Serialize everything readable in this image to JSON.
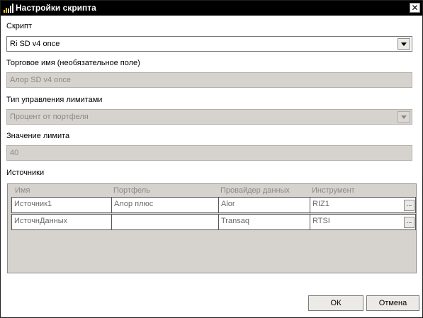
{
  "window": {
    "title": "Настройки скрипта",
    "icon": "bar-chart-icon",
    "close_label": "✕"
  },
  "script": {
    "label": "Скрипт",
    "value": "Ri SD v4 once"
  },
  "trade_name": {
    "label": "Торговое имя (необязательное поле)",
    "value": "Алор SD v4 once"
  },
  "limit_type": {
    "label": "Тип управления лимитами",
    "value": "Процент от портфеля"
  },
  "limit_value": {
    "label": "Значение лимита",
    "value": "40"
  },
  "sources": {
    "label": "Источники",
    "columns": [
      "Имя",
      "Портфель",
      "Провайдер данных",
      "Инструмент"
    ],
    "rows": [
      {
        "name": "Источник1",
        "portfolio": "Алор плюс",
        "provider": "Alor",
        "instrument": "RIZ1"
      },
      {
        "name": "ИсточнДанных",
        "portfolio": "",
        "provider": "Transaq",
        "instrument": "RTSI"
      }
    ],
    "ellipsis_label": "..."
  },
  "buttons": {
    "ok": "ОК",
    "cancel": "Отмена"
  },
  "colors": {
    "titlebar": "#000000",
    "disabled_field": "#d6d3ce",
    "grid_background": "#d6d3ce",
    "button_face": "#eceae6"
  }
}
